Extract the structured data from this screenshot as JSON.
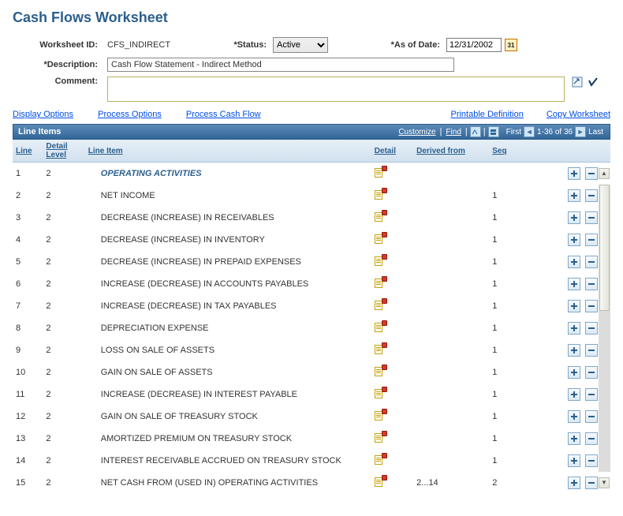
{
  "page_title": "Cash Flows Worksheet",
  "form": {
    "worksheet_id_label": "Worksheet ID:",
    "worksheet_id": "CFS_INDIRECT",
    "status_label": "*Status:",
    "status_value": "Active",
    "as_of_label": "*As of Date:",
    "as_of_value": "12/31/2002",
    "description_label": "*Description:",
    "description_value": "Cash Flow Statement - Indirect Method",
    "comment_label": "Comment:",
    "comment_value": ""
  },
  "links": {
    "display_options": "Display Options",
    "process_options": "Process Options",
    "process_cash_flow": "Process Cash Flow",
    "printable_definition": "Printable Definition",
    "copy_worksheet": "Copy Worksheet"
  },
  "grid": {
    "title": "Line Items",
    "customize": "Customize",
    "find": "Find",
    "first_label": "First",
    "range": "1-36 of 36",
    "last_label": "Last",
    "headers": {
      "line": "Line",
      "detail_level": "Detail Level",
      "line_item": "Line Item",
      "detail": "Detail",
      "derived_from": "Derived from",
      "seq": "Seq"
    },
    "rows": [
      {
        "line": "1",
        "level": "2",
        "item": "OPERATING ACTIVITIES",
        "section": true,
        "derived": "",
        "seq": ""
      },
      {
        "line": "2",
        "level": "2",
        "item": "NET INCOME",
        "derived": "",
        "seq": "1"
      },
      {
        "line": "3",
        "level": "2",
        "item": "DECREASE (INCREASE) IN RECEIVABLES",
        "derived": "",
        "seq": "1"
      },
      {
        "line": "4",
        "level": "2",
        "item": "DECREASE (INCREASE) IN INVENTORY",
        "derived": "",
        "seq": "1"
      },
      {
        "line": "5",
        "level": "2",
        "item": "DECREASE (INCREASE) IN PREPAID EXPENSES",
        "derived": "",
        "seq": "1"
      },
      {
        "line": "6",
        "level": "2",
        "item": "INCREASE (DECREASE) IN ACCOUNTS PAYABLES",
        "derived": "",
        "seq": "1"
      },
      {
        "line": "7",
        "level": "2",
        "item": "INCREASE (DECREASE) IN TAX PAYABLES",
        "derived": "",
        "seq": "1"
      },
      {
        "line": "8",
        "level": "2",
        "item": "DEPRECIATION EXPENSE",
        "derived": "",
        "seq": "1"
      },
      {
        "line": "9",
        "level": "2",
        "item": "LOSS ON SALE OF ASSETS",
        "derived": "",
        "seq": "1"
      },
      {
        "line": "10",
        "level": "2",
        "item": "GAIN ON SALE OF ASSETS",
        "derived": "",
        "seq": "1"
      },
      {
        "line": "11",
        "level": "2",
        "item": "INCREASE (DECREASE) IN INTEREST PAYABLE",
        "derived": "",
        "seq": "1"
      },
      {
        "line": "12",
        "level": "2",
        "item": "GAIN ON SALE OF TREASURY STOCK",
        "derived": "",
        "seq": "1"
      },
      {
        "line": "13",
        "level": "2",
        "item": "AMORTIZED PREMIUM ON TREASURY STOCK",
        "derived": "",
        "seq": "1"
      },
      {
        "line": "14",
        "level": "2",
        "item": "INTEREST RECEIVABLE ACCRUED ON TREASURY STOCK",
        "derived": "",
        "seq": "1"
      },
      {
        "line": "15",
        "level": "2",
        "item": "NET CASH FROM (USED IN) OPERATING ACTIVITIES",
        "derived": "2...14",
        "seq": "2"
      }
    ]
  }
}
